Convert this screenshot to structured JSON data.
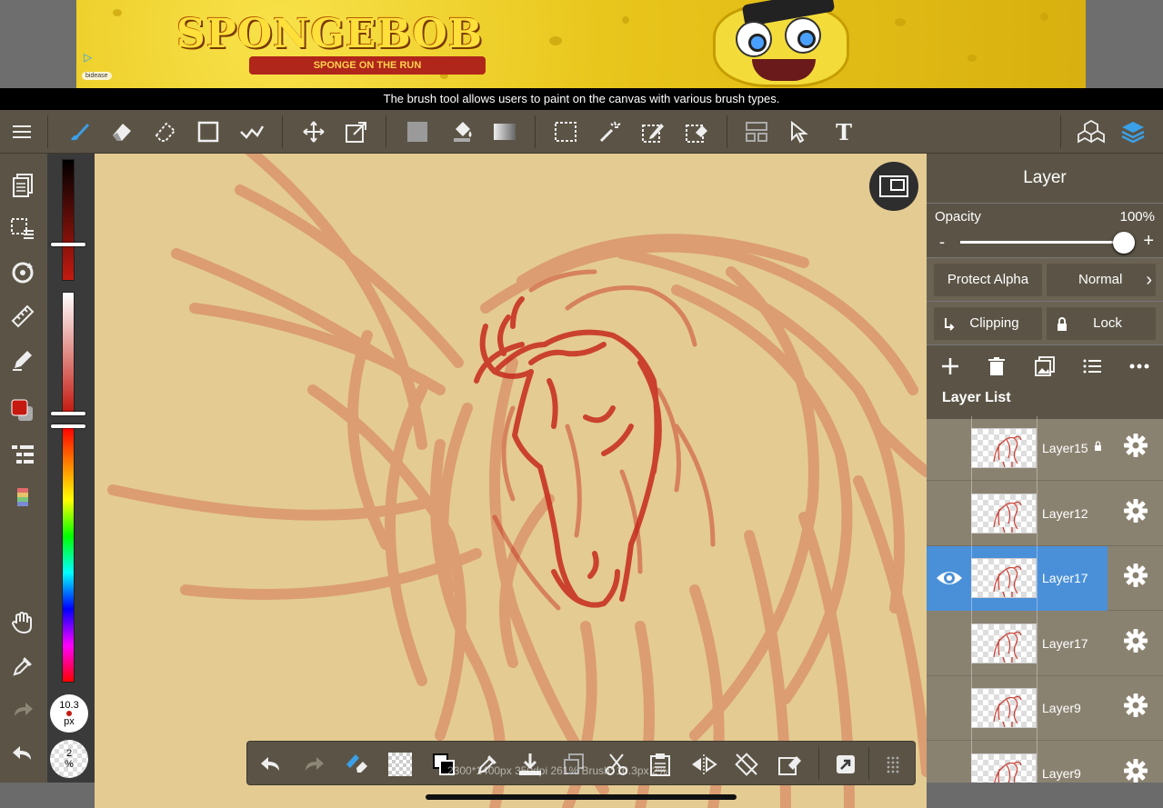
{
  "ad": {
    "logo": "SPONGEBOB",
    "subtitle": "SPONGE ON THE RUN",
    "network_label": "bidease",
    "adchoices": "▷"
  },
  "tooltip": "The brush tool allows users to paint on the canvas with various brush types.",
  "toolbar": {
    "menu_icon": "menu-icon",
    "tools": [
      "brush-icon",
      "eraser-icon",
      "blur-icon",
      "rectangle-icon",
      "stabilizer-icon",
      "move-icon",
      "transform-icon",
      "fill-color-icon",
      "bucket-icon",
      "gradient-icon",
      "select-rect-icon",
      "magic-wand-icon",
      "select-pen-icon",
      "select-eraser-icon",
      "layout-icon",
      "select-move-icon",
      "text-icon",
      "materials-icon",
      "layers-icon"
    ],
    "text_tool": "T"
  },
  "colors": {
    "accent": "#3aa0e8",
    "brush_color": "#c41a10",
    "panel_bg": "#5b5446",
    "selected_layer": "#4a90d9"
  },
  "brush": {
    "size": "10.3",
    "size_unit": "px",
    "opacity": "2",
    "opacity_unit": "%"
  },
  "bottom": {
    "status": "2300*1400px 350dpi 261% Brush: 10.3px 2%"
  },
  "layer_panel": {
    "title": "Layer",
    "opacity_label": "Opacity",
    "opacity_value": "100%",
    "opacity_fraction": 1.0,
    "minus": "-",
    "plus": "+",
    "protect_alpha": "Protect Alpha",
    "blend_mode": "Normal",
    "clipping": "Clipping",
    "lock": "Lock",
    "list_title": "Layer List",
    "layers": [
      {
        "name": "Layer15",
        "locked": true,
        "visible": false,
        "selected": false
      },
      {
        "name": "Layer12",
        "locked": false,
        "visible": false,
        "selected": false
      },
      {
        "name": "Layer17",
        "locked": false,
        "visible": true,
        "selected": true
      },
      {
        "name": "Layer17",
        "locked": false,
        "visible": false,
        "selected": false
      },
      {
        "name": "Layer9",
        "locked": false,
        "visible": false,
        "selected": false
      },
      {
        "name": "Layer9",
        "locked": false,
        "visible": false,
        "selected": false
      }
    ]
  }
}
